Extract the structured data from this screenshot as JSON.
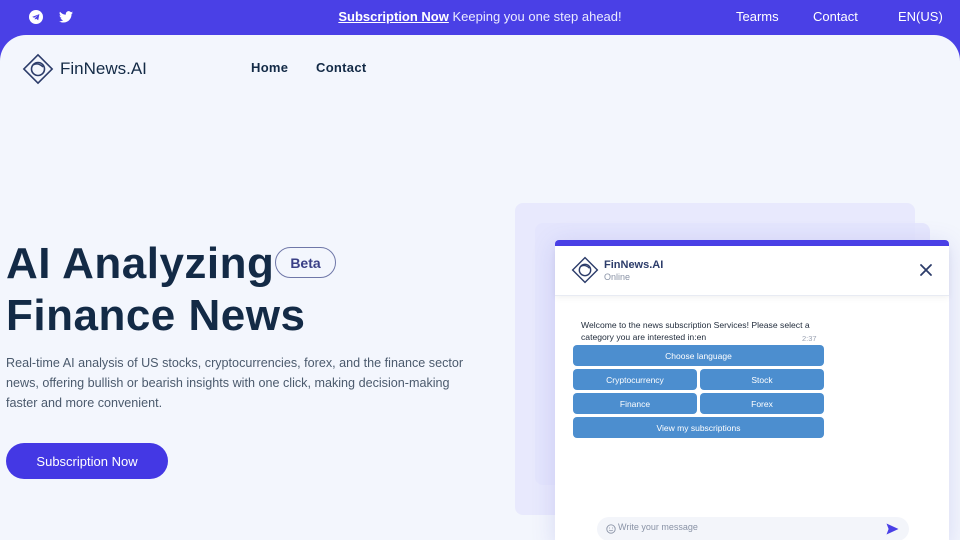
{
  "topbar": {
    "subscription_link": "Subscription Now",
    "tagline": "Keeping you one step ahead!",
    "links": [
      "Tearms",
      "Contact",
      "EN(US)"
    ],
    "social_icons": [
      "telegram-icon",
      "twitter-icon"
    ]
  },
  "header": {
    "brand": "FinNews.AI",
    "nav": [
      "Home",
      "Contact"
    ]
  },
  "hero": {
    "title_line1": "AI Analyzing",
    "title_line2": "Finance News",
    "badge": "Beta",
    "description": "Real-time AI analysis of US stocks, cryptocurrencies, forex, and the finance sector news, offering bullish or bearish insights with one click, making decision-making faster and more convenient.",
    "cta_label": "Subscription Now"
  },
  "chat": {
    "name": "FinNews.AI",
    "status": "Online",
    "message": "Welcome to the news subscription Services! Please select a category you are interested in:en",
    "time": "2:37",
    "options": {
      "language": "Choose language",
      "crypto": "Cryptocurrency",
      "stock": "Stock",
      "finance": "Finance",
      "forex": "Forex",
      "subscriptions": "View my subscriptions"
    },
    "input_placeholder": "Write your message"
  },
  "colors": {
    "accent": "#4a40e6",
    "page_bg": "#f3f6fd",
    "heading": "#132a46",
    "chat_button": "#4c8ecf"
  }
}
